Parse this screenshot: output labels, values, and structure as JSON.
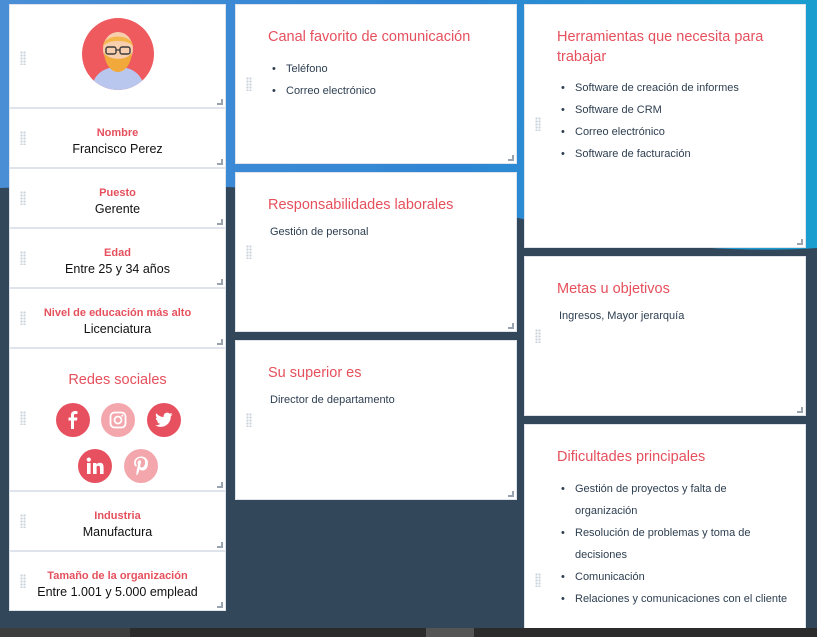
{
  "colors": {
    "accent": "#e5505d",
    "background": "#33475b",
    "band": "#2f86d4"
  },
  "profile": {
    "avatar_icon": "bearded-man-avatar-icon",
    "fields": [
      {
        "label": "Nombre",
        "value": "Francisco Perez"
      },
      {
        "label": "Puesto",
        "value": "Gerente"
      },
      {
        "label": "Edad",
        "value": "Entre 25 y 34 años"
      },
      {
        "label": "Nivel de educación más alto",
        "value": "Licenciatura"
      }
    ],
    "social_title": "Redes sociales",
    "social_icons": [
      "facebook-icon",
      "instagram-icon",
      "twitter-icon",
      "linkedin-icon",
      "pinterest-icon"
    ],
    "industry": {
      "label": "Industria",
      "value": "Manufactura"
    },
    "org_size": {
      "label": "Tamaño de la organización",
      "value": "Entre 1.001 y 5.000 emplead"
    }
  },
  "cards": {
    "canal": {
      "title": "Canal favorito de comunicación",
      "items": [
        "Teléfono",
        "Correo electrónico"
      ]
    },
    "responsabilidades": {
      "title": "Responsabilidades laborales",
      "text": "Gestión de personal"
    },
    "superior": {
      "title": "Su superior es",
      "text": "Director de departamento"
    },
    "herramientas": {
      "title": "Herramientas que necesita para trabajar",
      "items": [
        "Software de creación de informes",
        "Software de CRM",
        "Correo electrónico",
        "Software de facturación"
      ]
    },
    "metas": {
      "title": "Metas u objetivos",
      "text": "Ingresos, Mayor jerarquía"
    },
    "dificultades": {
      "title": "Dificultades principales",
      "items": [
        "Gestión de proyectos y falta de organización",
        "Resolución de problemas y toma de decisiones",
        "Comunicación",
        "Relaciones y comunicaciones con el cliente"
      ]
    }
  }
}
